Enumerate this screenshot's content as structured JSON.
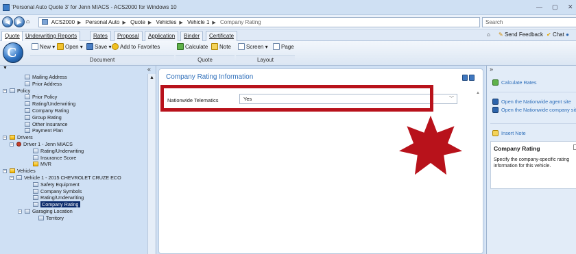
{
  "window": {
    "title": "'Personal Auto Quote 3' for Jenn MIACS - ACS2000 for Windows 10",
    "minimize": "—",
    "restore": "▢",
    "close": "✕"
  },
  "address": {
    "breadcrumbs": [
      "ACS2000",
      "Personal Auto",
      "Quote",
      "Vehicles",
      "Vehicle 1",
      "Company Rating"
    ],
    "search_placeholder": "Search"
  },
  "tabs": [
    {
      "label": "Quote",
      "active": true
    },
    {
      "label": "Underwriting Reports",
      "active": false
    },
    {
      "label": "Rates",
      "active": false
    },
    {
      "label": "Proposal",
      "active": false
    },
    {
      "label": "Application",
      "active": false
    },
    {
      "label": "Binder",
      "active": false
    },
    {
      "label": "Certificate",
      "active": false
    }
  ],
  "top_right": {
    "send_feedback": "Send Feedback",
    "chat": "Chat"
  },
  "ribbon": {
    "buttons": [
      "New",
      "Open",
      "Save",
      "Add to Favorites",
      "Calculate",
      "Note",
      "Screen",
      "Page"
    ],
    "groups": [
      "Document",
      "Quote",
      "Layout"
    ]
  },
  "tree": {
    "collapse_symbol": "«",
    "items": [
      {
        "label": "Mailing Address",
        "level": 2,
        "icon": "doc-icon"
      },
      {
        "label": "Prior Address",
        "level": 2,
        "icon": "doc-icon"
      },
      {
        "label": "Policy",
        "level": 0,
        "icon": "doc-icon",
        "toggle": "−"
      },
      {
        "label": "Prior Policy",
        "level": 2,
        "icon": "doc-icon"
      },
      {
        "label": "Rating/Underwriting",
        "level": 2,
        "icon": "doc-icon"
      },
      {
        "label": "Company Rating",
        "level": 2,
        "icon": "doc-icon"
      },
      {
        "label": "Group Rating",
        "level": 2,
        "icon": "doc-icon"
      },
      {
        "label": "Other Insurance",
        "level": 2,
        "icon": "doc-icon"
      },
      {
        "label": "Payment Plan",
        "level": 2,
        "icon": "doc-icon"
      },
      {
        "label": "Drivers",
        "level": 0,
        "icon": "folder-icon",
        "toggle": "−"
      },
      {
        "label": "Driver 1 - Jenn MIACS",
        "level": 1,
        "icon": "person-icon",
        "toggle": "−"
      },
      {
        "label": "Rating/Underwriting",
        "level": 3,
        "icon": "doc-icon"
      },
      {
        "label": "Insurance Score",
        "level": 3,
        "icon": "doc-icon"
      },
      {
        "label": "MVR",
        "level": 3,
        "icon": "folder-icon"
      },
      {
        "label": "Vehicles",
        "level": 0,
        "icon": "folder-icon",
        "toggle": "−"
      },
      {
        "label": "Vehicle 1 - 2015 CHEVROLET CRUZE ECO",
        "level": 1,
        "icon": "doc-icon",
        "toggle": "−"
      },
      {
        "label": "Safety Equipment",
        "level": 3,
        "icon": "doc-icon"
      },
      {
        "label": "Company Symbols",
        "level": 3,
        "icon": "doc-icon"
      },
      {
        "label": "Rating/Underwriting",
        "level": 3,
        "icon": "doc-icon"
      },
      {
        "label": "Company Rating",
        "level": 3,
        "icon": "doc-icon",
        "selected": true
      },
      {
        "label": "Garaging Location",
        "level": 2,
        "icon": "doc-icon",
        "toggle": "−"
      },
      {
        "label": "Territory",
        "level": 4,
        "icon": "doc-icon"
      }
    ]
  },
  "main": {
    "heading": "Company Rating Information",
    "field_label": "Nationwide Telematics",
    "field_value": "Yes",
    "highlight_color": "#b8121b",
    "star_color": "#b8121b"
  },
  "right": {
    "expand_symbol": "»",
    "links": [
      "Calculate Rates",
      "Open the Nationwide agent site",
      "Open the Nationwide company site",
      "Insert Note"
    ],
    "help_title": "Company Rating",
    "help_text": "Specify the company-specific rating information for this vehicle."
  }
}
